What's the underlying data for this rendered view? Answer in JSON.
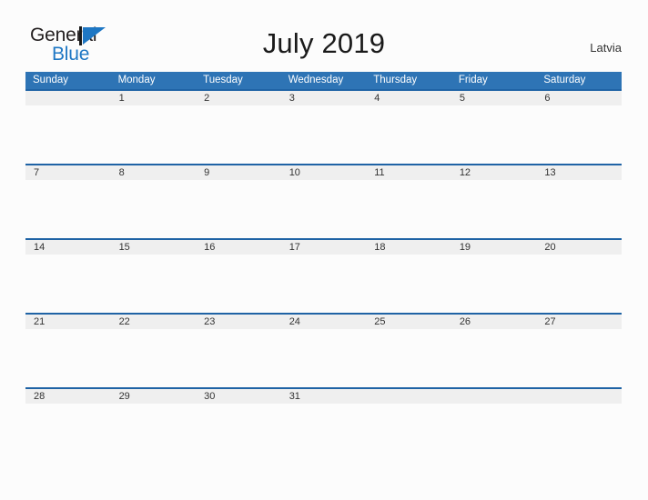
{
  "brand": {
    "name_part1": "General",
    "name_part2": "Blue",
    "flag_icon": "blue-flag-triangle-icon"
  },
  "header": {
    "title": "July 2019",
    "country": "Latvia"
  },
  "calendar": {
    "month": "July",
    "year": "2019",
    "weekday_headers": [
      "Sunday",
      "Monday",
      "Tuesday",
      "Wednesday",
      "Thursday",
      "Friday",
      "Saturday"
    ],
    "weeks": [
      [
        "",
        "1",
        "2",
        "3",
        "4",
        "5",
        "6"
      ],
      [
        "7",
        "8",
        "9",
        "10",
        "11",
        "12",
        "13"
      ],
      [
        "14",
        "15",
        "16",
        "17",
        "18",
        "19",
        "20"
      ],
      [
        "21",
        "22",
        "23",
        "24",
        "25",
        "26",
        "27"
      ],
      [
        "28",
        "29",
        "30",
        "31",
        "",
        "",
        ""
      ]
    ]
  },
  "colors": {
    "header_blue": "#2e74b5",
    "rule_blue": "#1f63a5",
    "date_band_gray": "#efefef",
    "page_background": "#fcfcfc",
    "brand_blue": "#1e77c4",
    "text_dark": "#231f20"
  }
}
